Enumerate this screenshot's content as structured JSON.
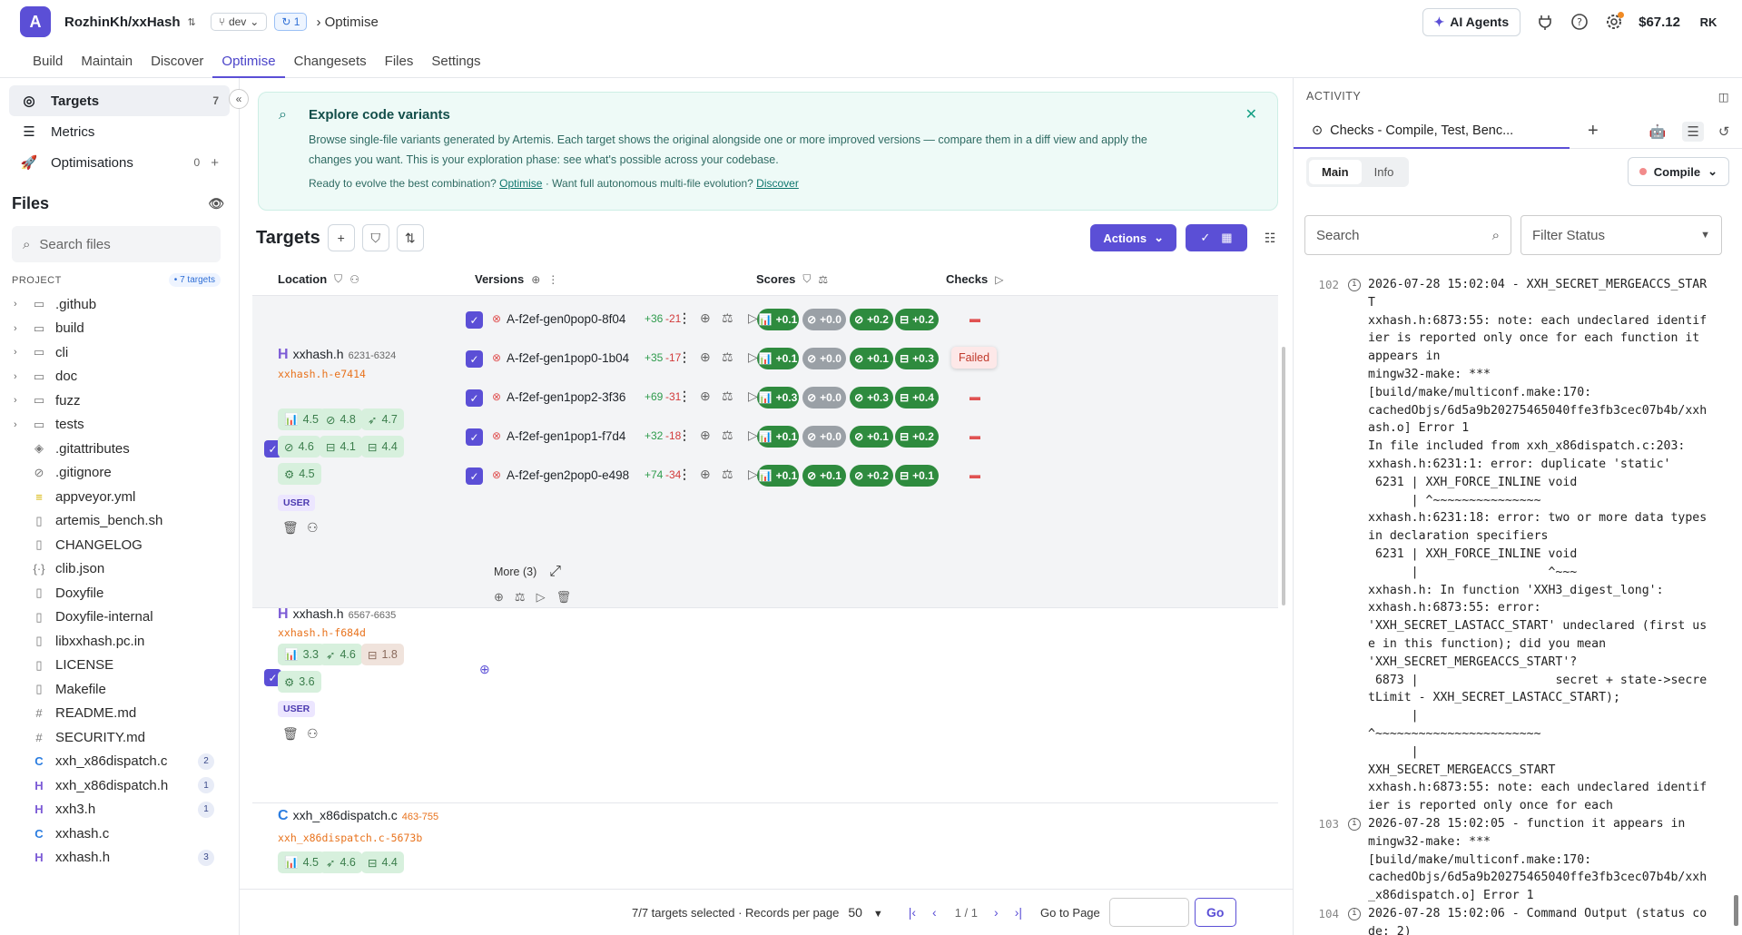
{
  "app": {
    "logo": "A",
    "repo": "RozhinKh/xxHash",
    "branch": "dev",
    "sync_count": "1",
    "crumb": "Optimise",
    "agents_label": "AI Agents",
    "credit": "$67.12",
    "avatar": "RK"
  },
  "nav": [
    "Build",
    "Maintain",
    "Discover",
    "Optimise",
    "Changesets",
    "Files",
    "Settings"
  ],
  "sidebar": {
    "items": [
      {
        "label": "Targets",
        "count": "7"
      },
      {
        "label": "Metrics",
        "count": ""
      },
      {
        "label": "Optimisations",
        "count": "0"
      }
    ],
    "files_title": "Files",
    "search_placeholder": "Search files",
    "project_label": "PROJECT",
    "project_badge": "• 7 targets",
    "tree": [
      {
        "name": ".github",
        "type": "dir"
      },
      {
        "name": "build",
        "type": "dir"
      },
      {
        "name": "cli",
        "type": "dir"
      },
      {
        "name": "doc",
        "type": "dir"
      },
      {
        "name": "fuzz",
        "type": "dir"
      },
      {
        "name": "tests",
        "type": "dir"
      },
      {
        "name": ".gitattributes",
        "type": "file",
        "icon": "◈"
      },
      {
        "name": ".gitignore",
        "type": "file",
        "icon": "⊘"
      },
      {
        "name": "appveyor.yml",
        "type": "file",
        "icon": "≡",
        "cls": "ic-y"
      },
      {
        "name": "artemis_bench.sh",
        "type": "file",
        "icon": ""
      },
      {
        "name": "CHANGELOG",
        "type": "file",
        "icon": ""
      },
      {
        "name": "clib.json",
        "type": "file",
        "icon": "{·}"
      },
      {
        "name": "Doxyfile",
        "type": "file",
        "icon": ""
      },
      {
        "name": "Doxyfile-internal",
        "type": "file",
        "icon": ""
      },
      {
        "name": "libxxhash.pc.in",
        "type": "file",
        "icon": ""
      },
      {
        "name": "LICENSE",
        "type": "file",
        "icon": ""
      },
      {
        "name": "Makefile",
        "type": "file",
        "icon": ""
      },
      {
        "name": "README.md",
        "type": "file",
        "icon": "#"
      },
      {
        "name": "SECURITY.md",
        "type": "file",
        "icon": "#"
      },
      {
        "name": "xxh_x86dispatch.c",
        "type": "file",
        "icon": "C",
        "cls": "ic-c",
        "badge": "2"
      },
      {
        "name": "xxh_x86dispatch.h",
        "type": "file",
        "icon": "H",
        "cls": "ic-h",
        "badge": "1"
      },
      {
        "name": "xxh3.h",
        "type": "file",
        "icon": "H",
        "cls": "ic-h",
        "badge": "1"
      },
      {
        "name": "xxhash.c",
        "type": "file",
        "icon": "C",
        "cls": "ic-c"
      },
      {
        "name": "xxhash.h",
        "type": "file",
        "icon": "H",
        "cls": "ic-h",
        "badge": "3"
      }
    ]
  },
  "banner": {
    "title": "Explore code variants",
    "line1": "Browse single-file variants generated by Artemis. Each target shows the original alongside one or more improved versions — compare them in a diff view and apply the",
    "line2": "changes you want. This is your exploration phase: see what's possible across your codebase.",
    "hint_a": "Ready to evolve the best combination?",
    "link_a": "Optimise",
    "hint_b": "· Want full autonomous multi-file evolution?",
    "link_b": "Discover"
  },
  "targets": {
    "title": "Targets",
    "actions_label": "Actions",
    "col_location": "Location",
    "col_versions": "Versions",
    "col_scores": "Scores",
    "col_checks": "Checks",
    "user_label": "USER",
    "more_label": "More (3)",
    "failed_label": "Failed"
  },
  "groups": [
    {
      "file": "xxhash.h",
      "range": "6231-6324",
      "hash": "xxhash.h-e7414",
      "metrics": [
        "4.5",
        "4.8",
        "4.7",
        "4.6",
        "4.1",
        "4.4",
        "4.5"
      ],
      "versions": [
        {
          "name": "A-f2ef-gen0pop0-8f04",
          "plus": "+36",
          "minus": "-21",
          "scores": [
            "+0.1",
            "+0.0",
            "+0.2",
            "+0.2"
          ]
        },
        {
          "name": "A-f2ef-gen1pop0-1b04",
          "plus": "+35",
          "minus": "-17",
          "scores": [
            "+0.1",
            "+0.0",
            "+0.1",
            "+0.3"
          ]
        },
        {
          "name": "A-f2ef-gen1pop2-3f36",
          "plus": "+69",
          "minus": "-31",
          "scores": [
            "+0.3",
            "+0.0",
            "+0.3",
            "+0.4"
          ]
        },
        {
          "name": "A-f2ef-gen1pop1-f7d4",
          "plus": "+32",
          "minus": "-18",
          "scores": [
            "+0.1",
            "+0.0",
            "+0.1",
            "+0.2"
          ]
        },
        {
          "name": "A-f2ef-gen2pop0-e498",
          "plus": "+74",
          "minus": "-34",
          "scores": [
            "+0.1",
            "+0.1",
            "+0.2",
            "+0.1"
          ]
        }
      ]
    },
    {
      "file": "xxhash.h",
      "range": "6567-6635",
      "hash": "xxhash.h-f684d",
      "metrics": [
        "3.3",
        "4.6",
        "1.8",
        "3.6"
      ]
    },
    {
      "file": "xxh_x86dispatch.c",
      "range": "463-755",
      "hash": "xxh_x86dispatch.c-5673b",
      "metrics": [
        "4.5",
        "4.6",
        "4.4"
      ]
    }
  ],
  "pager": {
    "selected": "7/7 targets selected",
    "per_page_label": "· Records per page",
    "per_page": "50",
    "page": "1 / 1",
    "goto_label": "Go to Page",
    "go": "Go"
  },
  "activity": {
    "title": "ACTIVITY",
    "tab": "Checks - Compile, Test, Benc...",
    "seg_main": "Main",
    "seg_info": "Info",
    "compile": "Compile",
    "search_placeholder": "Search",
    "filter_placeholder": "Filter Status",
    "log": [
      {
        "n": "102",
        "t": "2026-07-28 15:02:04 - XXH_SECRET_MERGEACCS_START\nxxhash.h:6873:55: note: each undeclared identifier is reported only once for each function it appears in\nmingw32-make: ***\n[build/make/multiconf.make:170:\ncachedObjs/6d5a9b20275465040ffe3fb3cec07b4b/xxhash.o] Error 1\nIn file included from xxh_x86dispatch.c:203:\nxxhash.h:6231:1: error: duplicate 'static'\n 6231 | XXH_FORCE_INLINE void\n      | ^~~~~~~~~~~~~~~~\nxxhash.h:6231:18: error: two or more data types in declaration specifiers\n 6231 | XXH_FORCE_INLINE void\n      |                  ^~~~\nxxhash.h: In function 'XXH3_digest_long':\nxxhash.h:6873:55: error:\n'XXH_SECRET_LASTACC_START' undeclared (first use in this function); did you mean\n'XXH_SECRET_MERGEACCS_START'?\n 6873 |                   secret + state->secretLimit - XXH_SECRET_LASTACC_START);\n      |\n^~~~~~~~~~~~~~~~~~~~~~~~\n      |\nXXH_SECRET_MERGEACCS_START\nxxhash.h:6873:55: note: each undeclared identifier is reported only once for each"
      },
      {
        "n": "103",
        "t": "2026-07-28 15:02:05 - function it appears in\nmingw32-make: ***\n[build/make/multiconf.make:170:\ncachedObjs/6d5a9b20275465040ffe3fb3cec07b4b/xxh_x86dispatch.o] Error 1"
      },
      {
        "n": "104",
        "t": "2026-07-28 15:02:06 - Command Output (status code: 2)"
      }
    ]
  }
}
